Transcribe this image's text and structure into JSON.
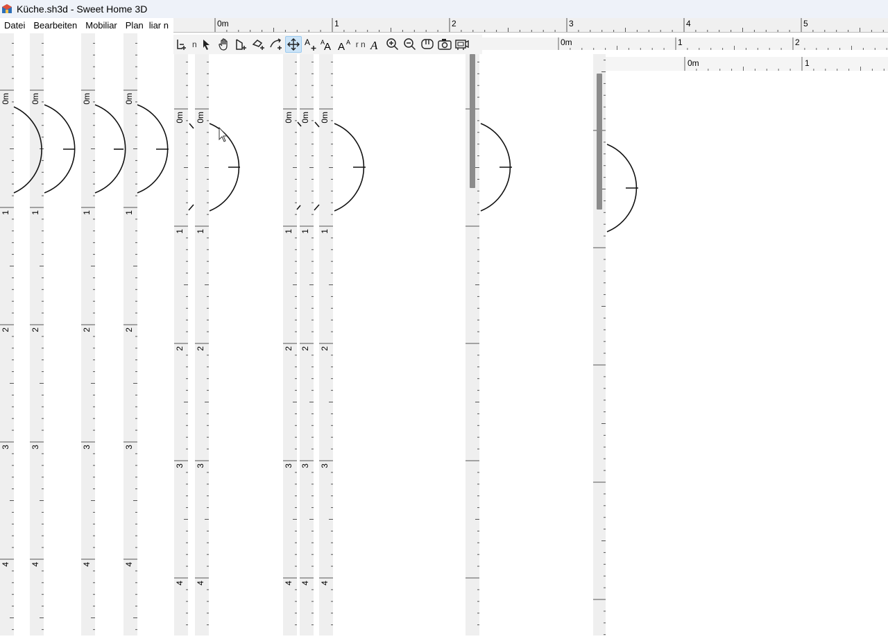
{
  "window": {
    "title": "Küche.sh3d - Sweet Home 3D",
    "app_icon": "sweet-home-3d-icon"
  },
  "menu": {
    "items": [
      "Datei",
      "Bearbeiten",
      "Mobiliar",
      "Plan"
    ],
    "clipped_text": "liar n"
  },
  "toolbar": {
    "buttons": [
      "add-level-icon",
      "select-arrow-icon",
      "pan-hand-icon",
      "create-room-icon",
      "create-polyline-icon",
      "create-dimension-icon",
      "create-walls-icon",
      "add-text-icon",
      "increase-text-size-icon",
      "decrease-text-size-icon",
      "italic-text-icon",
      "zoom-in-icon",
      "zoom-out-icon",
      "virtual-visit-icon",
      "camera-icon",
      "video-icon"
    ],
    "active_button": "create-walls-icon",
    "clipped_text_1": "n",
    "clipped_text_2": "r n"
  },
  "rulers": {
    "top_labels": [
      "0m",
      "1",
      "2",
      "3",
      "4",
      "5"
    ],
    "second_labels": [
      "0m",
      "1",
      "2"
    ],
    "third_labels": [
      "0m",
      "1"
    ],
    "vertical_labels": [
      "0m",
      "1",
      "2",
      "3",
      "4"
    ]
  },
  "colors": {
    "ruler_bg": "#efefef",
    "toolbar_bg": "#f3f3f3",
    "active_tool": "#cce4f7",
    "titlebar": "#eef2f9"
  }
}
